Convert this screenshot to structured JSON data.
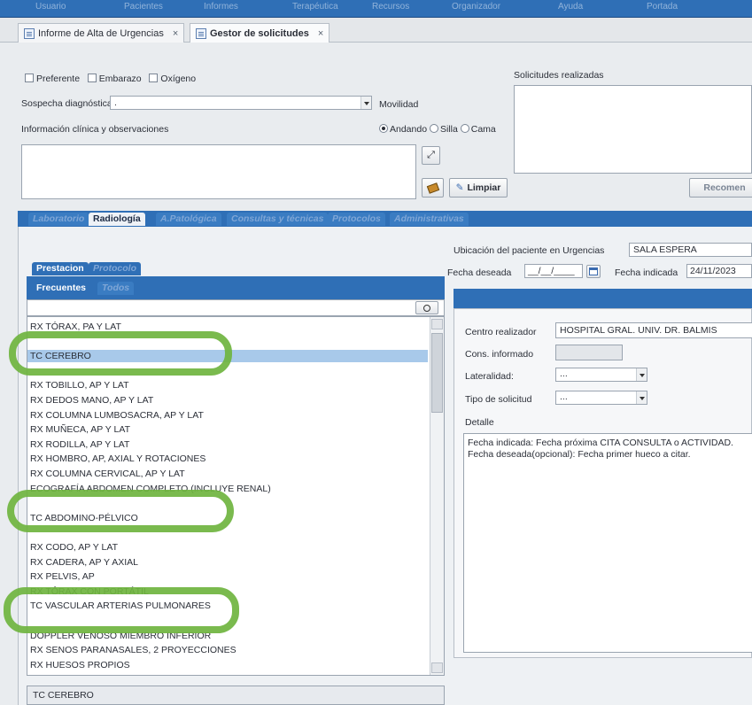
{
  "top_nav": [
    "Usuario",
    "Pacientes",
    "Informes",
    "Terapéutica",
    "Recursos",
    "Organizador",
    "Ayuda",
    "Portada"
  ],
  "doc_tabs": [
    {
      "label": "Informe de Alta de Urgencias",
      "active": false
    },
    {
      "label": "Gestor de solicitudes",
      "active": true
    }
  ],
  "flags": {
    "preferente": "Preferente",
    "embarazo": "Embarazo",
    "oxigeno": "Oxígeno"
  },
  "sospecha": {
    "label": "Sospecha diagnóstica",
    "value": "."
  },
  "info_clinica": {
    "label": "Información clínica y observaciones"
  },
  "movilidad": {
    "label": "Movilidad",
    "options": [
      "Andando",
      "Silla",
      "Cama"
    ],
    "selected": "Andando"
  },
  "solicitudes": {
    "label": "Solicitudes realizadas"
  },
  "buttons": {
    "limpiar": "Limpiar",
    "recomendar": "Recomen"
  },
  "section_tabs": [
    {
      "label": "Laboratorio",
      "active": false
    },
    {
      "label": "Radiología",
      "active": true
    },
    {
      "label": "A.Patológica",
      "active": false
    },
    {
      "label": "Consultas y técnicas",
      "active": false
    },
    {
      "label": "Protocolos",
      "active": false
    },
    {
      "label": "Administrativas",
      "active": false
    }
  ],
  "sub_tabs": [
    {
      "label": "Prestacion",
      "active": true
    },
    {
      "label": "Protocolo",
      "active": false
    }
  ],
  "list_tabs": [
    {
      "label": "Frecuentes",
      "active": true
    },
    {
      "label": "Todos",
      "active": false
    }
  ],
  "ubicacion": {
    "label": "Ubicación del paciente en Urgencias",
    "value": "SALA ESPERA"
  },
  "fecha_deseada": {
    "label": "Fecha deseada",
    "value": "__/__/____"
  },
  "fecha_indicada": {
    "label": "Fecha indicada",
    "value": "24/11/2023"
  },
  "prestaciones": [
    "RX TÓRAX, PA Y LAT",
    "",
    "TC CEREBRO",
    "",
    "RX TOBILLO, AP Y LAT",
    "RX DEDOS MANO, AP Y LAT",
    "RX COLUMNA LUMBOSACRA, AP Y LAT",
    "RX MUÑECA, AP Y LAT",
    "RX RODILLA, AP Y LAT",
    "RX HOMBRO, AP, AXIAL Y ROTACIONES",
    "RX COLUMNA CERVICAL, AP Y LAT",
    "ECOGRAFÍA ABDOMEN COMPLETO (INCLUYE RENAL)",
    "",
    "TC ABDOMINO-PÉLVICO",
    "",
    "RX CODO, AP Y LAT",
    "RX CADERA, AP Y AXIAL",
    "RX PELVIS, AP",
    "RX TÓRAX CON PORTÁTIL",
    "TC VASCULAR ARTERIAS PULMONARES",
    "",
    "DOPPLER VENOSO MIEMBRO INFERIOR",
    "RX SENOS PARANASALES, 2 PROYECCIONES",
    "RX HUESOS PROPIOS"
  ],
  "selected_item": "TC CEREBRO",
  "detalle_panel": {
    "centro_label": "Centro realizador",
    "centro_value": "HOSPITAL GRAL. UNIV. DR. BALMIS",
    "cons_label": "Cons. informado",
    "lateralidad_label": "Lateralidad:",
    "lateralidad_value": "...",
    "tipo_label": "Tipo de solicitud",
    "tipo_value": "...",
    "detalle_label": "Detalle",
    "detalle_text_1": "Fecha indicada: Fecha próxima CITA CONSULTA o ACTIVIDAD.",
    "detalle_text_2": "Fecha deseada(opcional): Fecha primer hueco a citar."
  },
  "colors": {
    "accent": "#2f6fb6",
    "highlight": "#a8c9ea",
    "marker": "#6fb43f"
  }
}
